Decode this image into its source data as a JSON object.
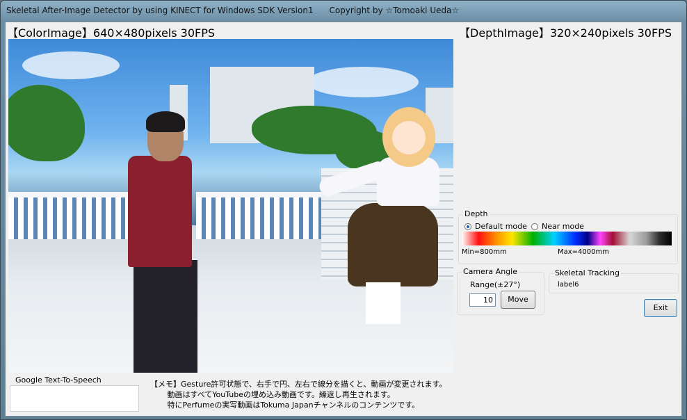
{
  "window": {
    "title": "Skeletal After-Image Detector by using KINECT for Windows SDK Version1      Copyright by ☆Tomoaki Ueda☆"
  },
  "color_image": {
    "label": "【ColorImage】640×480pixels 30FPS"
  },
  "depth_image": {
    "label": "【DepthImage】320×240pixels 30FPS"
  },
  "depth_group": {
    "title": "Depth",
    "default_mode": {
      "label": "Default mode",
      "selected": true
    },
    "near_mode": {
      "label": "Near mode",
      "selected": false
    },
    "min_label": "Min=800mm",
    "max_label": "Max=4000mm"
  },
  "camera_angle": {
    "title": "Camera Angle",
    "range_label": "Range(±27°)",
    "value": "10",
    "move_label": "Move"
  },
  "skeletal_tracking": {
    "title": "Skeletal Tracking",
    "value": "label6"
  },
  "exit_label": "Exit",
  "speech": {
    "title": "Google Text-To-Speech",
    "value": ""
  },
  "memo": [
    "【メモ】Gesture許可状態で、右手で円、左右で線分を描くと、動画が変更されます。",
    "       動画はすべてYouTubeの埋め込み動画です。繰返し再生されます。",
    "       特にPerfumeの実写動画はTokuma Japanチャンネルのコンテンツです。"
  ]
}
